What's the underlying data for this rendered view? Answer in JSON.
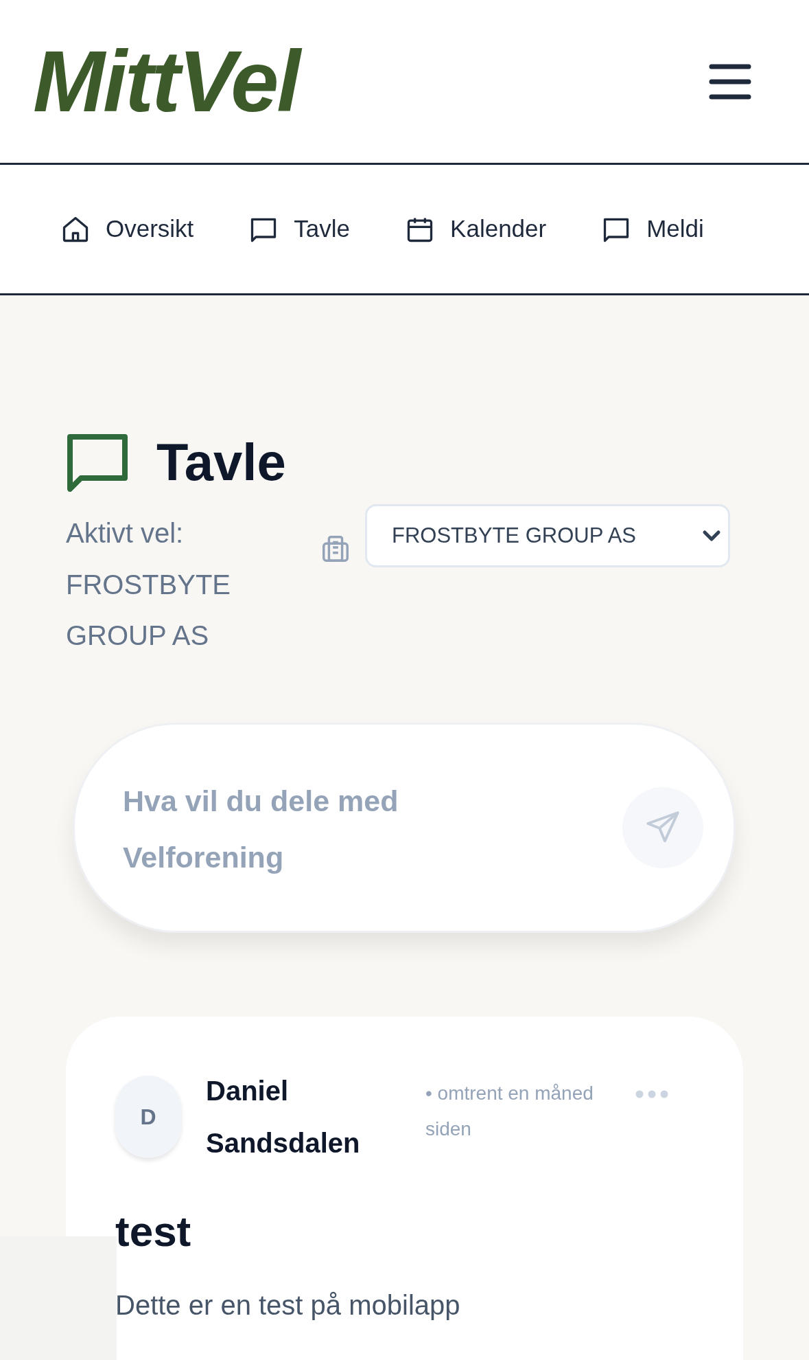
{
  "header": {
    "logo": "MittVel"
  },
  "nav": {
    "items": [
      {
        "label": "Oversikt",
        "kind": "home"
      },
      {
        "label": "Tavle",
        "kind": "chat"
      },
      {
        "label": "Kalender",
        "kind": "calendar"
      },
      {
        "label": "Meldi",
        "kind": "chat"
      }
    ]
  },
  "page": {
    "title": "Tavle",
    "active_label": "Aktivt vel:",
    "active_name": "FROSTBYTE GROUP AS",
    "select_value": "FROSTBYTE GROUP AS"
  },
  "composer": {
    "placeholder": "Hva vil du dele med Velforening"
  },
  "post": {
    "avatar": "D",
    "author": "Daniel Sandsdalen",
    "time": "• omtrent en måned siden",
    "title": "test",
    "body": "Dette er en test på mobilapp"
  }
}
